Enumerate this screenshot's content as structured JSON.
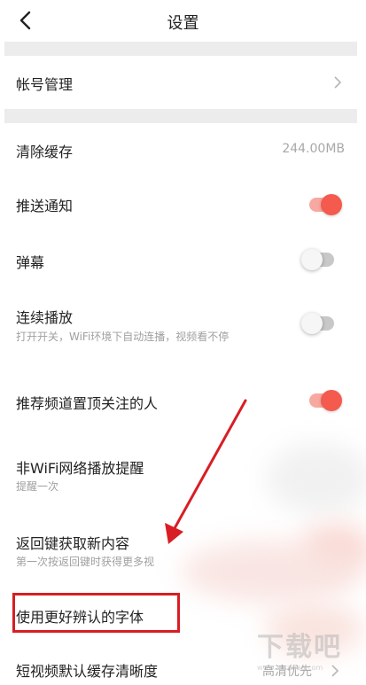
{
  "header": {
    "title": "设置",
    "back_icon": "chevron-left-icon"
  },
  "settings": {
    "account": {
      "label": "帐号管理"
    },
    "clear_cache": {
      "label": "清除缓存",
      "value": "244.00MB"
    },
    "push_notification": {
      "label": "推送通知",
      "enabled": true
    },
    "danmaku": {
      "label": "弹幕",
      "enabled": false
    },
    "autoplay": {
      "label": "连续播放",
      "sub": "打开开关，WiFi环境下自动连播，视频看不停",
      "enabled": false
    },
    "pin_followed": {
      "label": "推荐频道置顶关注的人",
      "enabled": true
    },
    "non_wifi_alert": {
      "label": "非WiFi网络播放提醒",
      "sub": "提醒一次"
    },
    "back_refresh": {
      "label": "返回键获取新内容",
      "sub": "第一次按返回键时获得更多视"
    },
    "readable_font": {
      "label": "使用更好辨认的字体"
    },
    "short_video_quality": {
      "label": "短视频默认缓存清晰度",
      "value": "高清优先"
    }
  },
  "colors": {
    "accent": "#f55a4e",
    "annotation": "#d81e24",
    "divider": "#ececec"
  },
  "watermark": {
    "text": "下载吧",
    "url": "www.xiazaiba.com"
  }
}
